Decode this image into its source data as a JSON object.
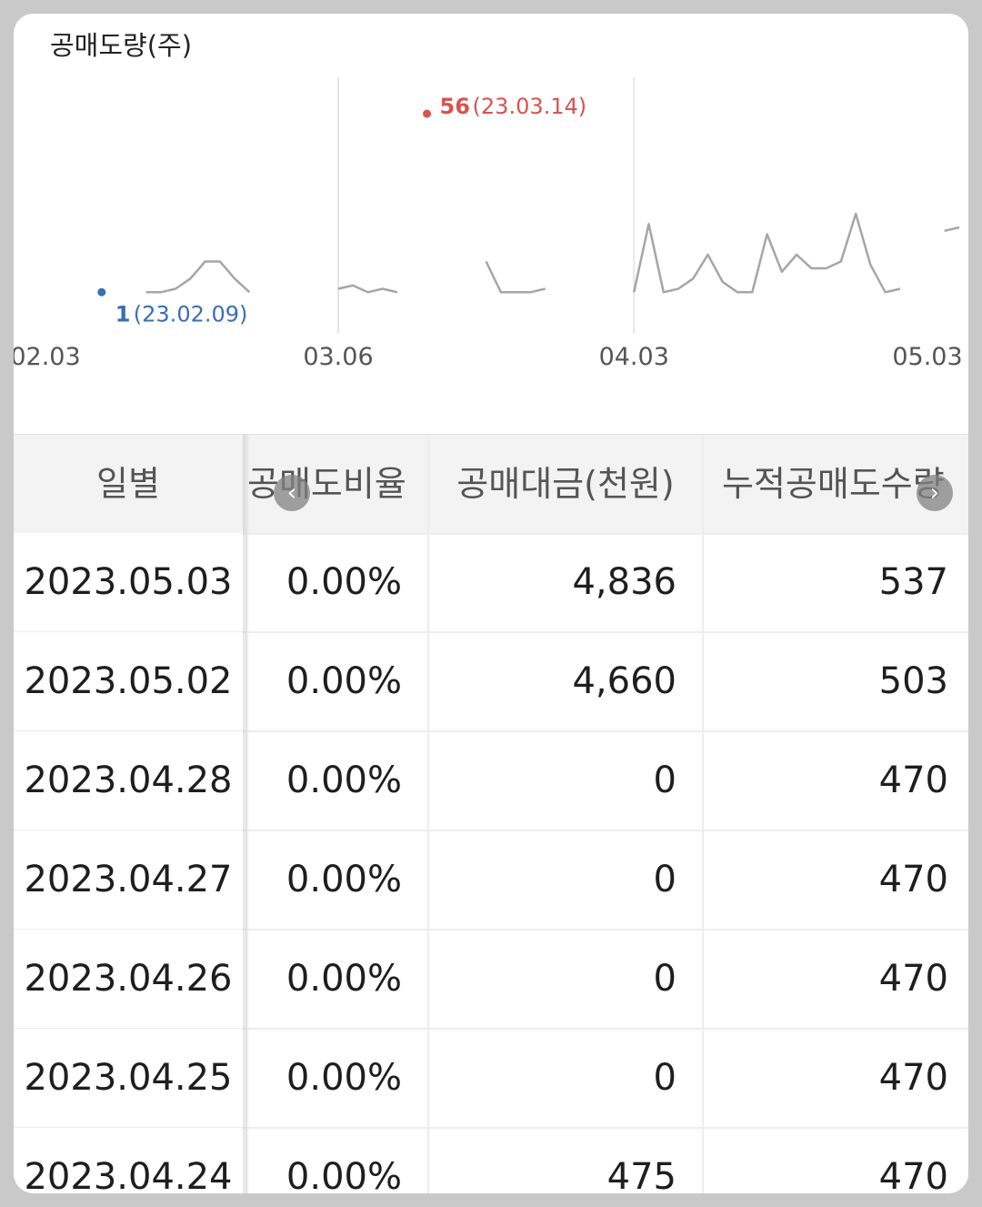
{
  "chart": {
    "title": "공매도량(주)",
    "max_annotation": {
      "value": "56",
      "date": "(23.03.14)",
      "color": "#d9534f"
    },
    "min_annotation": {
      "value": "1",
      "date": "(23.02.09)",
      "color": "#3a6fb0"
    },
    "x_ticks": [
      "02.03",
      "03.06",
      "04.03",
      "05.03"
    ]
  },
  "chart_data": {
    "type": "line",
    "x": [
      "02.06",
      "02.07",
      "02.08",
      "02.09",
      "02.10",
      "02.13",
      "02.14",
      "02.15",
      "02.16",
      "02.17",
      "02.20",
      "02.21",
      "02.22",
      "02.23",
      "02.24",
      "02.27",
      "02.28",
      "03.02",
      "03.03",
      "03.06",
      "03.07",
      "03.08",
      "03.09",
      "03.10",
      "03.13",
      "03.14",
      "03.15",
      "03.16",
      "03.17",
      "03.20",
      "03.21",
      "03.22",
      "03.23",
      "03.24",
      "03.27",
      "03.28",
      "03.29",
      "03.30",
      "03.31",
      "04.03",
      "04.04",
      "04.05",
      "04.06",
      "04.07",
      "04.10",
      "04.11",
      "04.12",
      "04.13",
      "04.14",
      "04.17",
      "04.18",
      "04.19",
      "04.20",
      "04.21",
      "04.24",
      "04.25",
      "04.26",
      "04.27",
      "04.28",
      "05.02",
      "05.03"
    ],
    "values": [
      3,
      null,
      null,
      1,
      null,
      null,
      1,
      1,
      2,
      5,
      10,
      10,
      5,
      1,
      null,
      null,
      null,
      null,
      null,
      2,
      3,
      1,
      2,
      1,
      null,
      null,
      null,
      null,
      null,
      10,
      1,
      1,
      1,
      2,
      null,
      null,
      null,
      null,
      null,
      1,
      21,
      1,
      2,
      5,
      12,
      4,
      1,
      1,
      18,
      7,
      12,
      8,
      8,
      10,
      24,
      9,
      1,
      2,
      null,
      null,
      19,
      20
    ],
    "xlabel": "",
    "ylabel": "",
    "ylim": [
      0,
      56
    ]
  },
  "table": {
    "headers": [
      "일별",
      "공매도비율",
      "공매대금(천원)",
      "누적공매도수량"
    ],
    "rows": [
      [
        "2023.05.03",
        "0.00%",
        "4,836",
        "537"
      ],
      [
        "2023.05.02",
        "0.00%",
        "4,660",
        "503"
      ],
      [
        "2023.04.28",
        "0.00%",
        "0",
        "470"
      ],
      [
        "2023.04.27",
        "0.00%",
        "0",
        "470"
      ],
      [
        "2023.04.26",
        "0.00%",
        "0",
        "470"
      ],
      [
        "2023.04.25",
        "0.00%",
        "0",
        "470"
      ],
      [
        "2023.04.24",
        "0.00%",
        "475",
        "470"
      ]
    ]
  },
  "scroll_left_icon": "chevron-left-icon",
  "scroll_right_icon": "chevron-right-icon",
  "scroll_left_glyph": "‹",
  "scroll_right_glyph": "›"
}
